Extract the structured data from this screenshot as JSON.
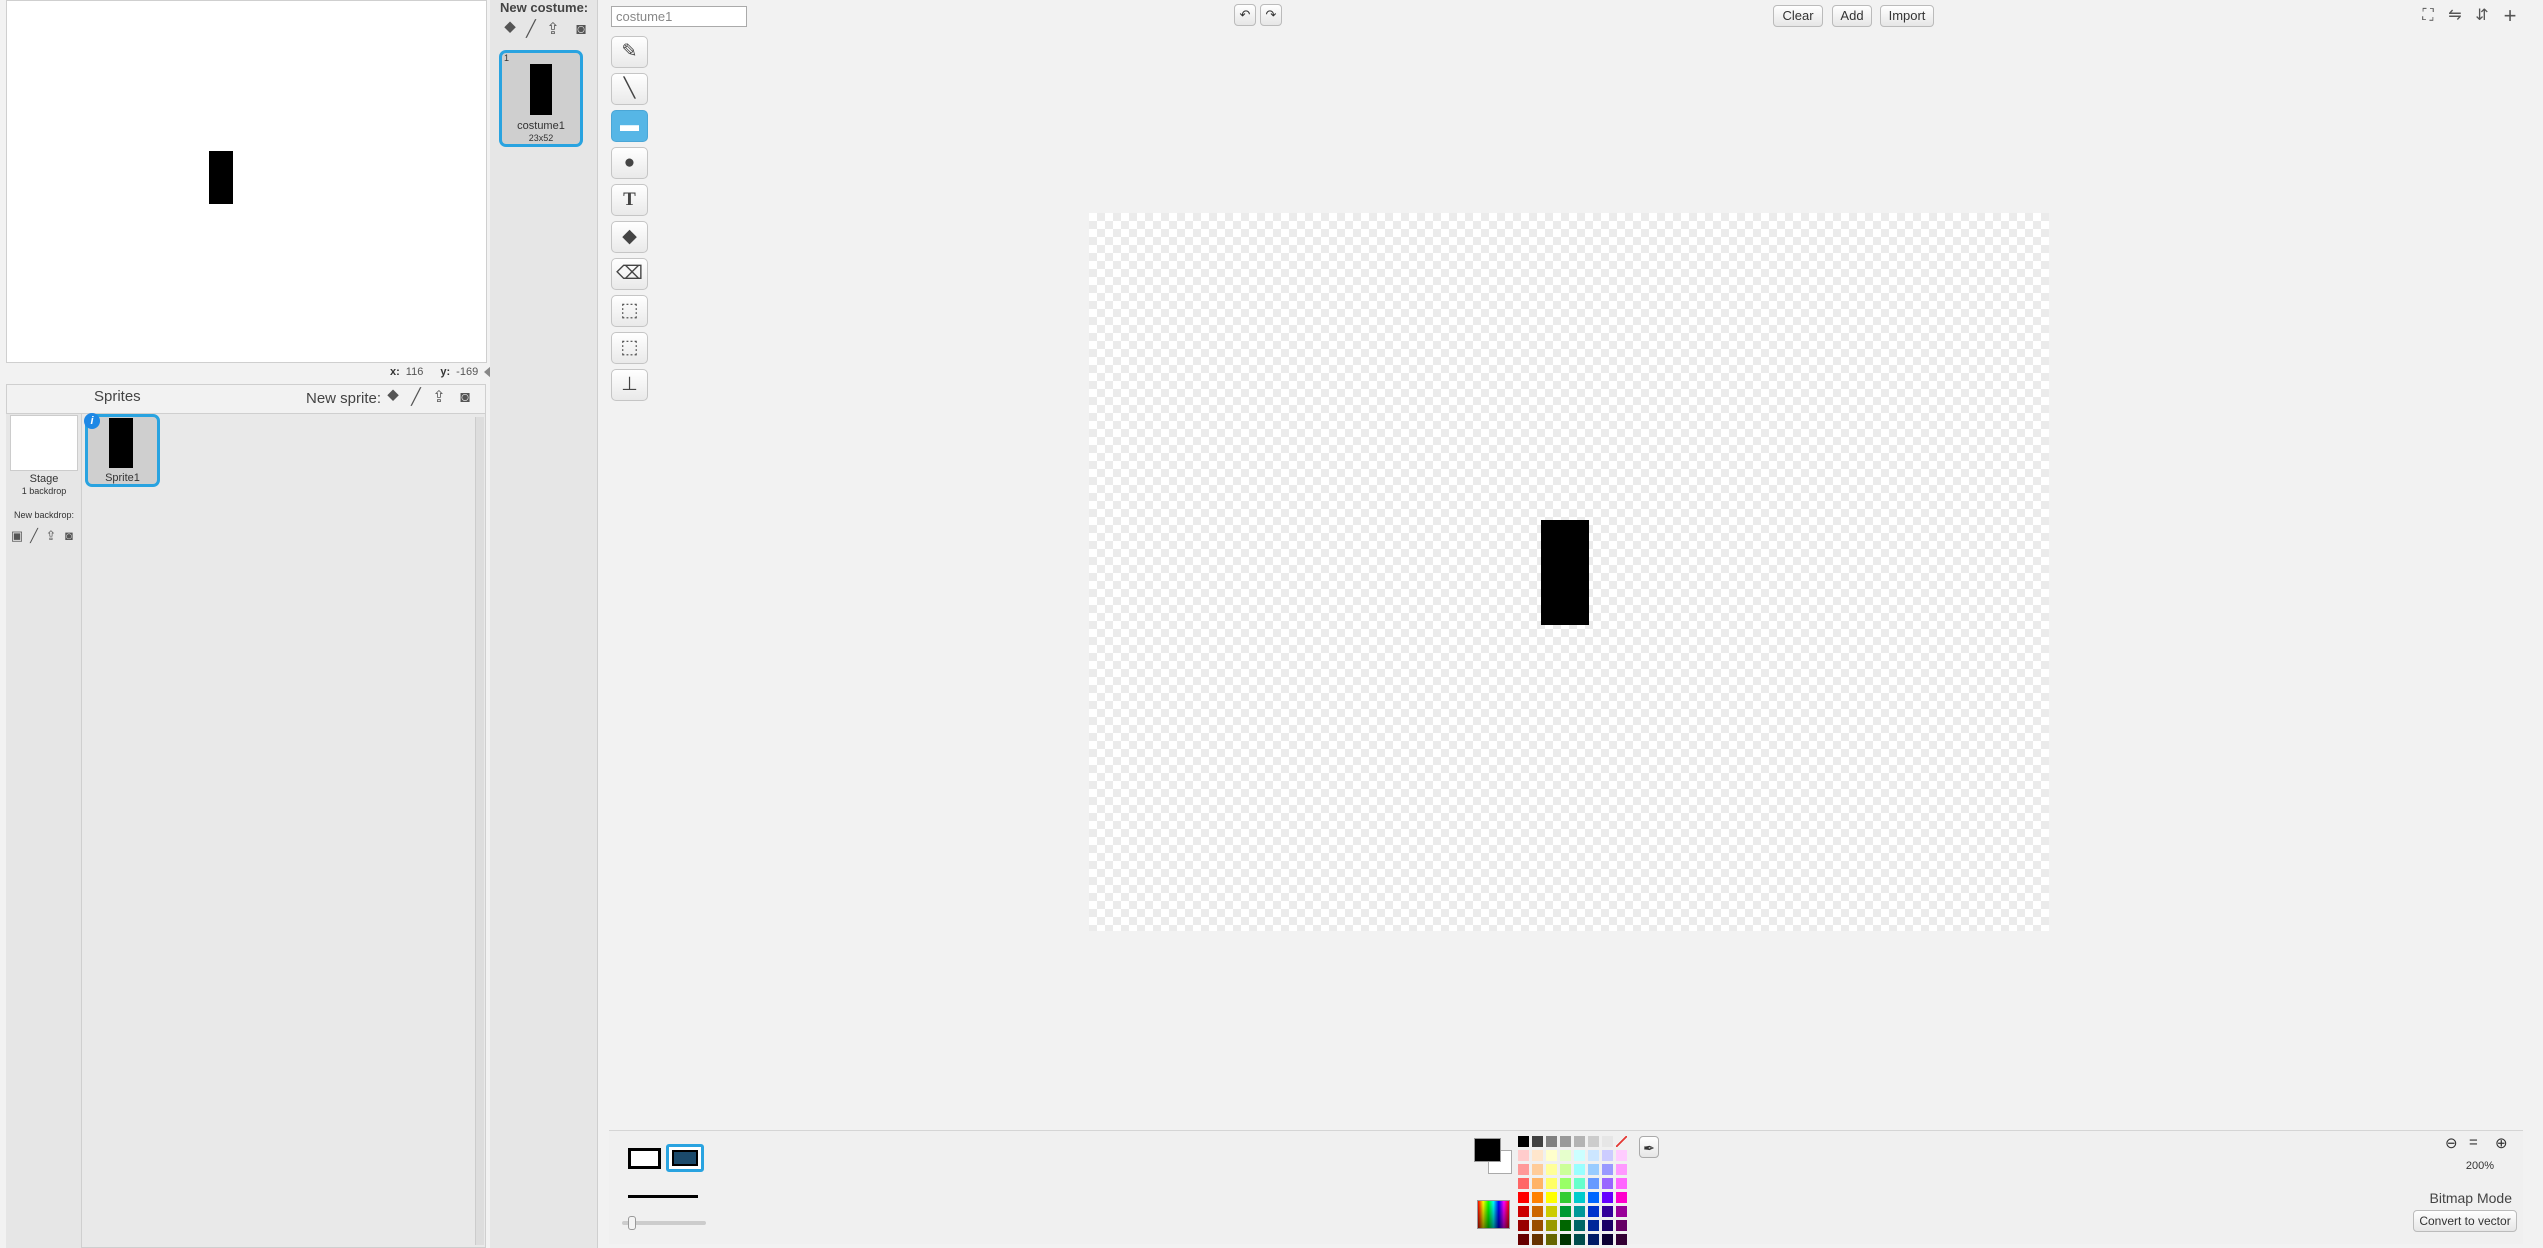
{
  "stage": {
    "coords": {
      "x_label": "x:",
      "x_value": "116",
      "y_label": "y:",
      "y_value": "-169"
    }
  },
  "sprites_panel": {
    "title": "Sprites",
    "new_sprite_label": "New sprite:",
    "stage_item": {
      "label": "Stage",
      "sublabel": "1 backdrop"
    },
    "new_backdrop_label": "New backdrop:",
    "sprites": [
      {
        "label": "Sprite1"
      }
    ]
  },
  "costumes": {
    "new_costume_label": "New costume:",
    "items": [
      {
        "number": "1",
        "name": "costume1",
        "size": "23x52"
      }
    ]
  },
  "editor": {
    "costume_name": "costume1",
    "buttons": {
      "clear": "Clear",
      "add": "Add",
      "import": "Import"
    },
    "tools": [
      {
        "name": "brush",
        "icon": "brush-icon",
        "glyph": "✎"
      },
      {
        "name": "line",
        "icon": "line-icon",
        "glyph": "╲"
      },
      {
        "name": "rectangle",
        "icon": "rectangle-icon",
        "glyph": "▬"
      },
      {
        "name": "ellipse",
        "icon": "ellipse-icon",
        "glyph": "●"
      },
      {
        "name": "text",
        "icon": "text-icon",
        "glyph": "T"
      },
      {
        "name": "fill",
        "icon": "paint-bucket-icon",
        "glyph": "◆"
      },
      {
        "name": "eraser",
        "icon": "eraser-icon",
        "glyph": "⌫"
      },
      {
        "name": "select",
        "icon": "select-icon",
        "glyph": "⬚"
      },
      {
        "name": "select-remove-background",
        "icon": "wand-select-icon",
        "glyph": "⬚"
      },
      {
        "name": "stamp",
        "icon": "stamp-icon",
        "glyph": "⊥"
      }
    ],
    "active_tool": "rectangle",
    "zoom": {
      "level": "200%",
      "out_glyph": "⊖",
      "reset_glyph": "=",
      "in_glyph": "⊕"
    },
    "mode_label": "Bitmap Mode",
    "convert_label": "Convert to vector",
    "colors": {
      "primary": "#000000",
      "secondary": "#ffffff",
      "accent": "#29a3e0",
      "palette": [
        "#000000",
        "#404040",
        "#808080",
        "#999999",
        "#b3b3b3",
        "#cccccc",
        "#e6e6e6",
        "transparent",
        "#ffcccc",
        "#ffe6cc",
        "#ffffcc",
        "#e6ffcc",
        "#ccffff",
        "#cce6ff",
        "#ccccff",
        "#ffccff",
        "#ff9999",
        "#ffcc99",
        "#ffff99",
        "#ccff99",
        "#99ffff",
        "#99ccff",
        "#9999ff",
        "#ff99ff",
        "#ff6666",
        "#ffb366",
        "#ffff66",
        "#99ff66",
        "#66ffcc",
        "#6699ff",
        "#9966ff",
        "#ff66ff",
        "#ff0000",
        "#ff8000",
        "#ffff00",
        "#33cc33",
        "#00cccc",
        "#0066ff",
        "#6600ff",
        "#ff00cc",
        "#cc0000",
        "#cc6600",
        "#cccc00",
        "#009933",
        "#009999",
        "#0033cc",
        "#330099",
        "#990099",
        "#990000",
        "#994d00",
        "#999900",
        "#006600",
        "#006666",
        "#002699",
        "#1a0066",
        "#660066",
        "#660000",
        "#663300",
        "#666600",
        "#003300",
        "#004d4d",
        "#001a66",
        "#0d0033",
        "#330033"
      ]
    }
  }
}
